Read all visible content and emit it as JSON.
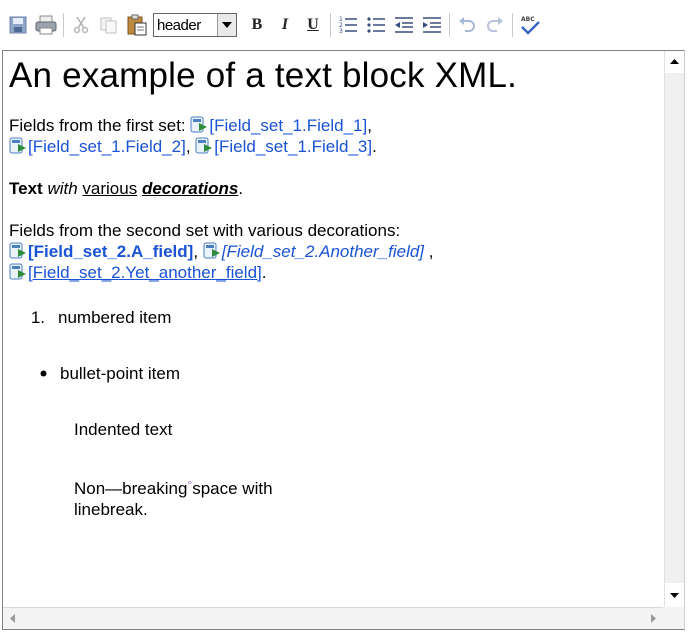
{
  "toolbar": {
    "format_select": "header",
    "bold_label": "B",
    "italic_label": "I",
    "underline_label": "U"
  },
  "content": {
    "heading": "An example of a text block XML.",
    "para1": {
      "prefix": "Fields from the first set: ",
      "field1": "[Field_set_1.Field_1]",
      "sep1": ",",
      "field2": "[Field_set_1.Field_2]",
      "sep2": ", ",
      "field3": "[Field_set_1.Field_3]",
      "suffix": "."
    },
    "para2": {
      "bold": "Text",
      "italic": "with",
      "underline": "various",
      "bolditalicunderline": "decorations",
      "suffix": "."
    },
    "para3": {
      "prefix": "Fields from the second set with various decorations:",
      "field1": "[Field_set_2.A_field]",
      "sep1": ", ",
      "field2": "[Field_set_2.Another_field]",
      "sep2": " ,",
      "field3": "[Field_set_2.Yet_another_field]",
      "suffix": "."
    },
    "numbered_marker": "1.",
    "numbered_item": "numbered item",
    "bullet_item": "bullet-point item",
    "indented_text": "Indented text",
    "nbsp_line1_a": "Non—breaking",
    "nbsp_line1_b": "space with",
    "nbsp_line2": "linebreak."
  },
  "colors": {
    "field_link": "#1a53d6"
  }
}
